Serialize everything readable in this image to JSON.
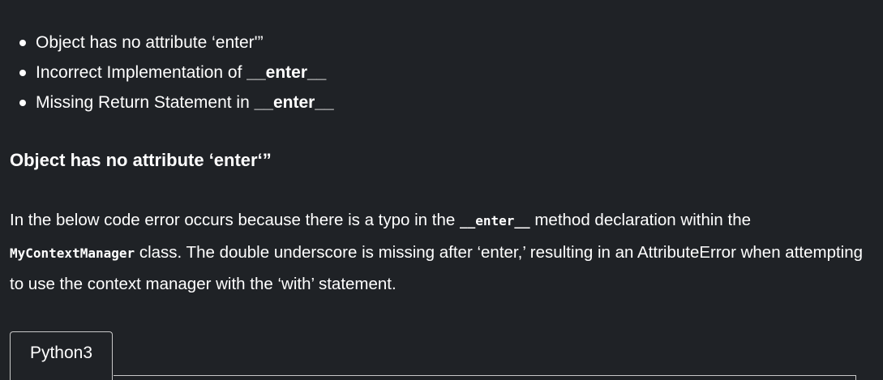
{
  "toc": {
    "items": [
      {
        "text": "Object has no attribute ‘enter'”",
        "bold": ""
      },
      {
        "text": "Incorrect Implementation of ",
        "bold": "__enter__"
      },
      {
        "text": "Missing Return Statement in ",
        "bold": "__enter__"
      }
    ]
  },
  "section": {
    "heading": "Object has no attribute ‘enter‘”",
    "paragraph": {
      "p1": "In the below code error occurs because there is a typo in the ",
      "code1": "__enter__",
      "p2": " method declaration within the ",
      "code2": "MyContextManager",
      "p3": " class. The double underscore is missing after ‘enter,’ resulting in an AttributeError when attempting to use the context manager with the ‘with’ statement."
    }
  },
  "code_tabs": {
    "active": "Python3"
  }
}
